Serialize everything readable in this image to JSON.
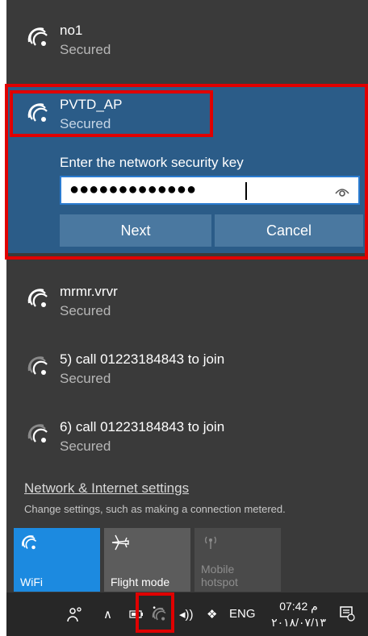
{
  "networks": [
    {
      "name": "no1",
      "status": "Secured"
    },
    {
      "name": "PVTD_AP",
      "status": "Secured"
    },
    {
      "name": "mrmr.vrvr",
      "status": "Secured"
    },
    {
      "name": "5) call 01223184843 to join",
      "status": "Secured"
    },
    {
      "name": "6) call 01223184843 to join",
      "status": "Secured"
    }
  ],
  "connect_form": {
    "prompt": "Enter the network security key",
    "password_value": "●●●●●●●●●●●●●",
    "next_label": "Next",
    "cancel_label": "Cancel"
  },
  "settings": {
    "link": "Network & Internet settings",
    "subtext": "Change settings, such as making a connection metered."
  },
  "quick_actions": [
    {
      "label": "WiFi",
      "icon": "wifi-icon",
      "state": "on"
    },
    {
      "label": "Flight mode",
      "icon": "airplane-icon",
      "state": "off"
    },
    {
      "label": "Mobile hotspot",
      "icon": "hotspot-icon",
      "state": "disabled"
    }
  ],
  "taskbar": {
    "language": "ENG",
    "time": "07:42 م",
    "date": "٢٠١٨/٠٧/١٣"
  },
  "colors": {
    "panel": "#3a3a3a",
    "selected": "#2b5c88",
    "accent": "#1c8ae0",
    "highlight": "#e00000"
  }
}
